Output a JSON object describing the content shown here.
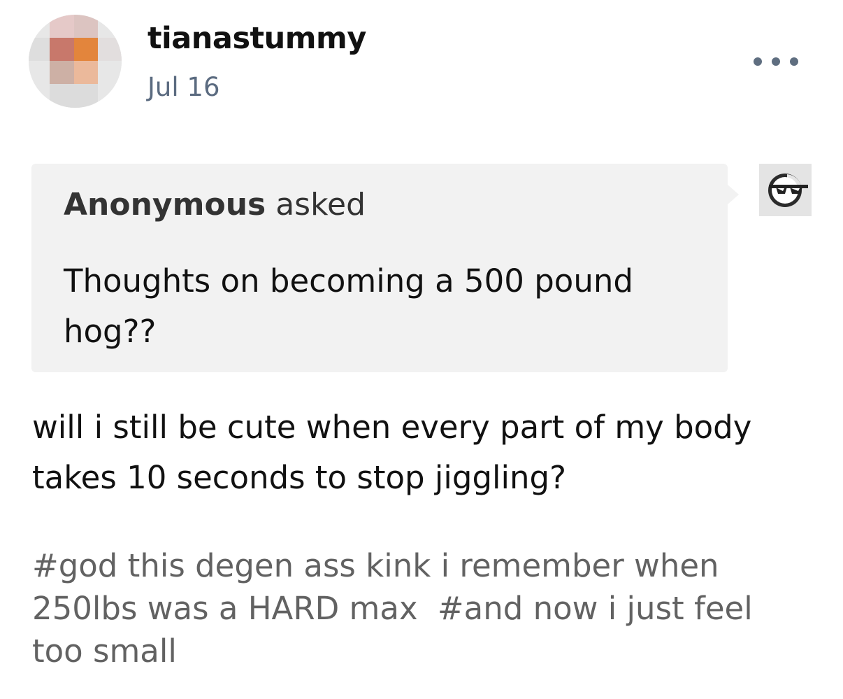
{
  "post": {
    "username": "tianastummy",
    "date": "Jul 16",
    "more_icon": "ellipsis-icon"
  },
  "ask": {
    "asker": "Anonymous",
    "verb": "asked",
    "question": "Thoughts on becoming a 500 pound hog??",
    "asker_avatar_icon": "sunglasses-face-icon"
  },
  "answer": {
    "text": "will i still be cute when every part of my body takes 10 seconds to stop jiggling?"
  },
  "tags": [
    "#god this degen ass kink i remember when 250lbs was a HARD max",
    "#and now i just feel too small"
  ],
  "colors": {
    "date": "#5b6b80",
    "ask_background": "#f2f2f2",
    "tag_text": "#626262",
    "more_dots": "#5f6e80"
  }
}
